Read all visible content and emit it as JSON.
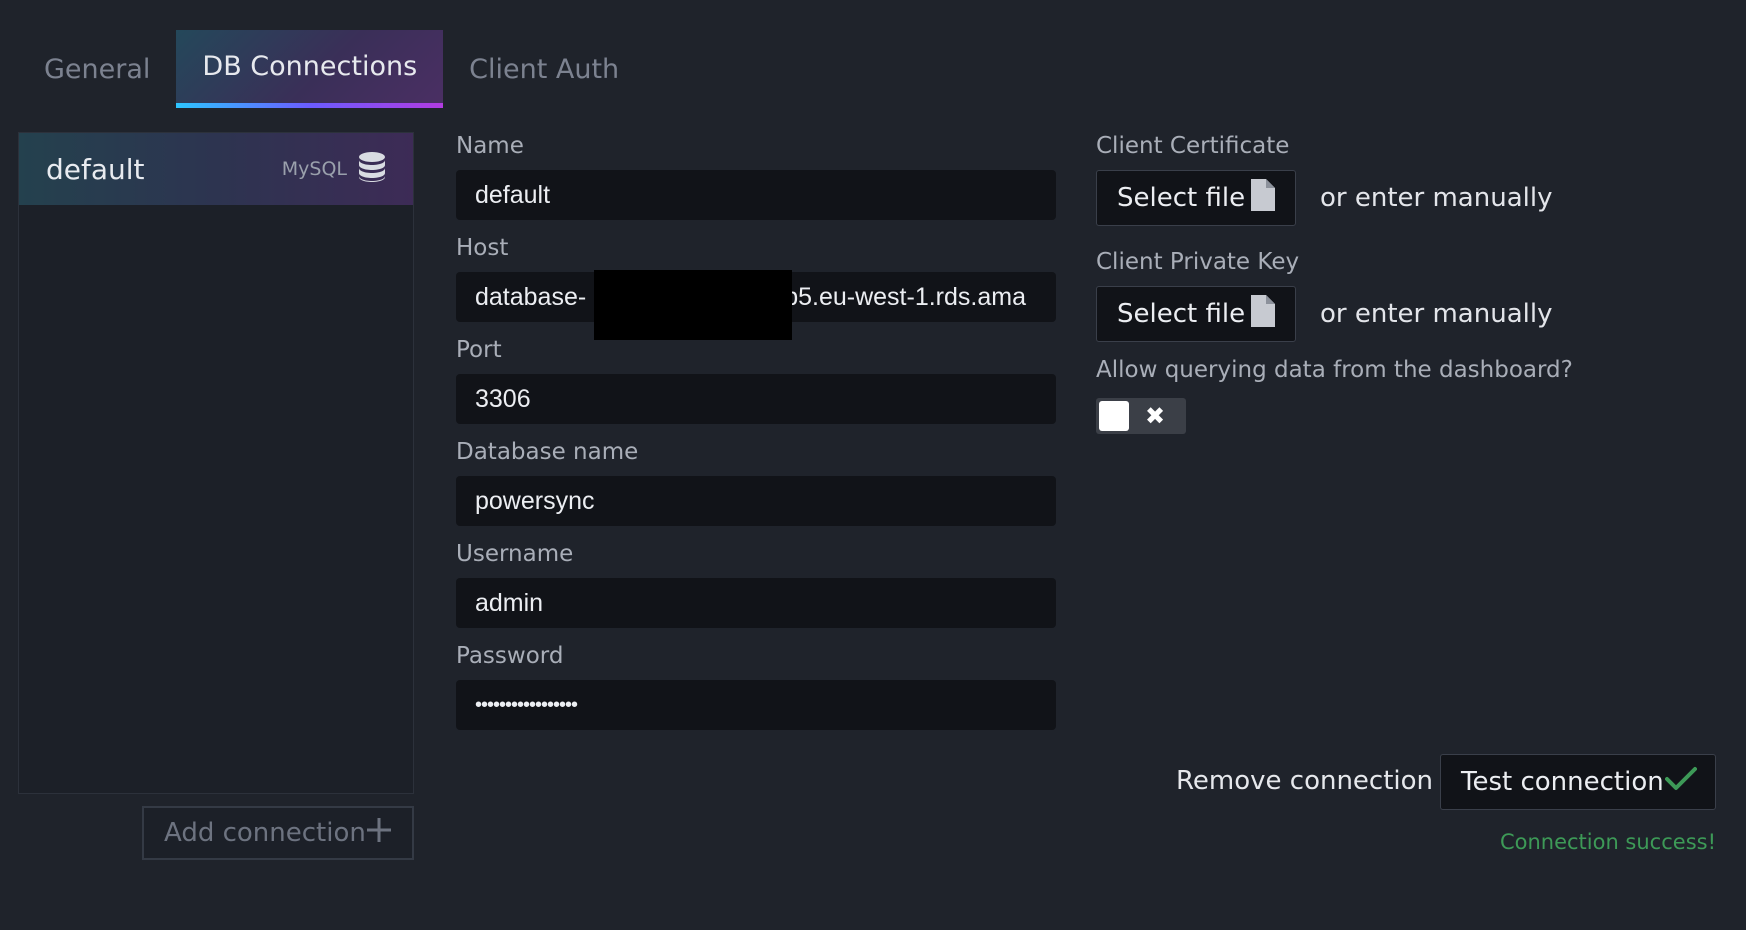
{
  "tabs": [
    {
      "label": "General"
    },
    {
      "label": "DB Connections"
    },
    {
      "label": "Client Auth"
    }
  ],
  "connections": [
    {
      "name": "default",
      "type": "MySQL",
      "icon": "database-icon"
    }
  ],
  "add_connection_label": "Add connection",
  "form": {
    "name_label": "Name",
    "name_value": "default",
    "host_label": "Host",
    "host_value_prefix": "database-",
    "host_value_suffix": "p5.eu-west-1.rds.ama",
    "port_label": "Port",
    "port_value": "3306",
    "dbname_label": "Database name",
    "dbname_value": "powersync",
    "username_label": "Username",
    "username_value": "admin",
    "password_label": "Password",
    "password_value": "•••••••••••••••••"
  },
  "client_auth": {
    "cert_label": "Client Certificate",
    "cert_button": "Select file",
    "cert_or": "or enter manually",
    "key_label": "Client Private Key",
    "key_button": "Select file",
    "key_or": "or enter manually",
    "query_label": "Allow querying data from the dashboard?",
    "query_enabled": false
  },
  "actions": {
    "remove_label": "Remove connection",
    "test_label": "Test connection",
    "status_text": "Connection success!"
  },
  "colors": {
    "background": "#1f232b",
    "input_bg": "#111318",
    "success": "#3d9a57",
    "tab_gradient_start": "#2cc6ff",
    "tab_gradient_end": "#b23be0"
  }
}
